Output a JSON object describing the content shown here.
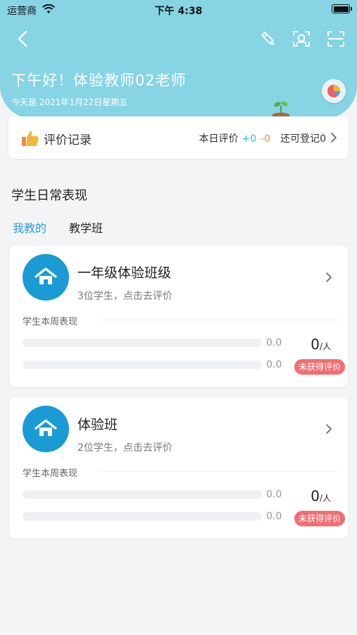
{
  "status_bar": {
    "carrier": "运营商",
    "time": "下午 4:38"
  },
  "header": {
    "greeting": "下午好！体验教师02老师",
    "date": "今天是 2021年1月22日星期五",
    "background_color": "#86d4e4",
    "nav_icons": [
      "back-icon",
      "pencil-icon",
      "face-scan-icon",
      "scan-icon"
    ]
  },
  "record": {
    "title": "评价记录",
    "today_label": "本日评价",
    "plus": "+0",
    "minus": "-0",
    "remaining": "还可登记0"
  },
  "section": {
    "title": "学生日常表现",
    "tabs": [
      {
        "label": "我教的",
        "active": true
      },
      {
        "label": "教学班",
        "active": false
      }
    ]
  },
  "classes": [
    {
      "name": "一年级体验班级",
      "subtitle": "3位学生，点击去评价",
      "week_label": "学生本周表现",
      "bar1_value": "0.0",
      "bar2_value": "0.0",
      "count": "0",
      "count_unit": "/人",
      "badge": "未获得评价"
    },
    {
      "name": "体验班",
      "subtitle": "2位学生，点击去评价",
      "week_label": "学生本周表现",
      "bar1_value": "0.0",
      "bar2_value": "0.0",
      "count": "0",
      "count_unit": "/人",
      "badge": "未获得评价"
    }
  ],
  "colors": {
    "accent": "#2b9fd6",
    "badge": "#f26e72",
    "plus": "#2bc4c9",
    "minus": "#f08a3c",
    "avatar": "#1a9bd4"
  }
}
